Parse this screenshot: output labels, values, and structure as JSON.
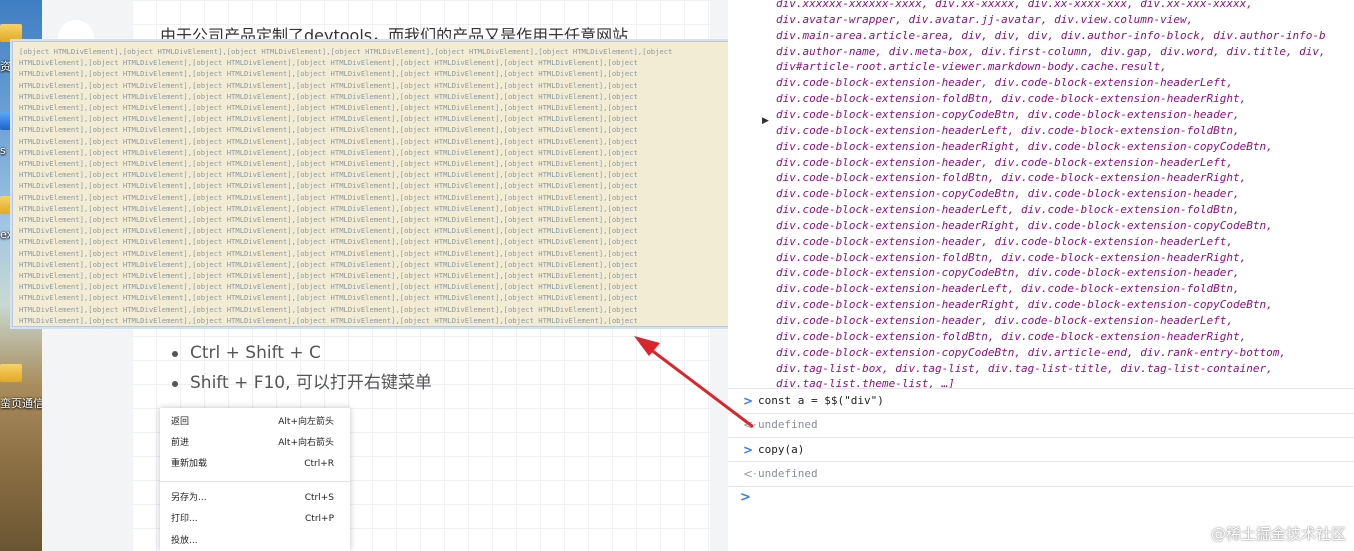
{
  "desktop": {
    "labels": [
      {
        "text": "资"
      },
      {
        "text": "s"
      },
      {
        "text": "ex"
      },
      {
        "text": "蛮页通信"
      }
    ]
  },
  "article": {
    "paragraph": "由于公司产品定制了devtools，而我们的产品又是作用于任意网站",
    "tips": [
      "Ctrl + Shift + C",
      "Shift + F10, 可以打开右键菜单"
    ]
  },
  "context_menu": {
    "groups": [
      [
        {
          "label": "返回",
          "shortcut": "Alt+向左箭头"
        },
        {
          "label": "前进",
          "shortcut": "Alt+向右箭头"
        },
        {
          "label": "重新加载",
          "shortcut": "Ctrl+R"
        }
      ],
      [
        {
          "label": "另存为...",
          "shortcut": "Ctrl+S"
        },
        {
          "label": "打印...",
          "shortcut": "Ctrl+P"
        },
        {
          "label": "投放...",
          "shortcut": ""
        }
      ]
    ]
  },
  "clipboard_popup": {
    "first_line": "[object HTMLDivElement],[object HTMLDivElement],[object HTMLDivElement],[object HTMLDivElement],[object HTMLDivElement],[object HTMLDivElement],[object",
    "repeat_line": "HTMLDivElement],[object HTMLDivElement],[object HTMLDivElement],[object HTMLDivElement],[object HTMLDivElement],[object HTMLDivElement],[object"
  },
  "console": {
    "element_list_lines": [
      "div.xxxxxx-xxxxxx-xxxx,  div.xx-xxxxx,  div.xx-xxxx-xxx,  div.xx-xxx-xxxxx,",
      "div.avatar-wrapper,  div.avatar.jj-avatar,  div.view.column-view,",
      "div.main-area.article-area,  div,  div,  div,  div.author-info-block,  div.author-info-b",
      "div.author-name,  div.meta-box,  div.first-column,  div.gap,  div.word,  div.title,  div,",
      "div#article-root.article-viewer.markdown-body.cache.result,",
      "div.code-block-extension-header,  div.code-block-extension-headerLeft,",
      "div.code-block-extension-foldBtn,  div.code-block-extension-headerRight,",
      "div.code-block-extension-copyCodeBtn,  div.code-block-extension-header,",
      "div.code-block-extension-headerLeft,  div.code-block-extension-foldBtn,",
      "div.code-block-extension-headerRight,  div.code-block-extension-copyCodeBtn,",
      "div.code-block-extension-header,  div.code-block-extension-headerLeft,",
      "div.code-block-extension-foldBtn,  div.code-block-extension-headerRight,",
      "div.code-block-extension-copyCodeBtn,  div.code-block-extension-header,",
      "div.code-block-extension-headerLeft,  div.code-block-extension-foldBtn,",
      "div.code-block-extension-headerRight,  div.code-block-extension-copyCodeBtn,",
      "div.code-block-extension-header,  div.code-block-extension-headerLeft,",
      "div.code-block-extension-foldBtn,  div.code-block-extension-headerRight,",
      "div.code-block-extension-copyCodeBtn,  div.code-block-extension-header,",
      "div.code-block-extension-headerLeft,  div.code-block-extension-foldBtn,",
      "div.code-block-extension-headerRight,  div.code-block-extension-copyCodeBtn,",
      "div.code-block-extension-header,  div.code-block-extension-headerLeft,",
      "div.code-block-extension-foldBtn,  div.code-block-extension-headerRight,",
      "div.code-block-extension-copyCodeBtn,  div.article-end,  div.rank-entry-bottom,",
      "div.tag-list-box,  div.tag-list,  div.tag-list-title,  div.tag-list-container,",
      "div.tag-list.theme-list,  …]"
    ],
    "entries": [
      {
        "kind": "input",
        "glyph": ">",
        "text": "const a = $$(\"div\")"
      },
      {
        "kind": "output",
        "glyph": "<·",
        "text": "undefined"
      },
      {
        "kind": "input",
        "glyph": ">",
        "text": "copy(a)"
      },
      {
        "kind": "output",
        "glyph": "<·",
        "text": "undefined"
      }
    ],
    "prompt_glyph": ">"
  },
  "watermark": "@稀土掘金技术社区",
  "colors": {
    "arrow": "#d9262c",
    "tag": "#881280",
    "popup_bg": "#f2ecd4"
  }
}
